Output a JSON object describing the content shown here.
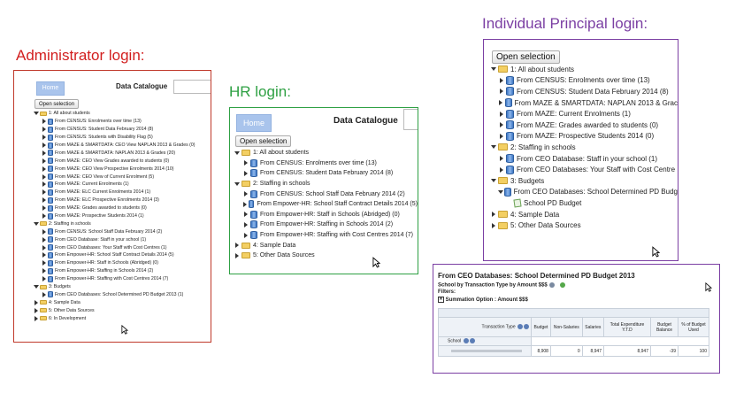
{
  "titles": {
    "admin": "Administrator login:",
    "hr": "HR login:",
    "principal": "Individual Principal login:"
  },
  "colors": {
    "admin": "#d21f1f",
    "hr": "#2ea043",
    "principal": "#7b3fa3"
  },
  "common": {
    "home": "Home",
    "catalogue": "Data Catalogue",
    "open_selection": "Open selection"
  },
  "admin_tree": [
    {
      "label": "1: All about students",
      "level": 0,
      "icon": "folder",
      "open": true
    },
    {
      "label": "From CENSUS: Enrolments over time (13)",
      "level": 1,
      "icon": "db"
    },
    {
      "label": "From CENSUS: Student Data February 2014 (8)",
      "level": 1,
      "icon": "db"
    },
    {
      "label": "From CENSUS: Students with Disability Flag (5)",
      "level": 1,
      "icon": "db"
    },
    {
      "label": "From MAZE & SMARTDATA: CEO View NAPLAN 2013 & Grades (0)",
      "level": 1,
      "icon": "db"
    },
    {
      "label": "From MAZE & SMARTDATA: NAPLAN 2013 & Grades (20)",
      "level": 1,
      "icon": "db"
    },
    {
      "label": "From MAZE: CEO View Grades awarded to students (0)",
      "level": 1,
      "icon": "db"
    },
    {
      "label": "From MAZE: CEO View Prospective Enrolments 2014 (10)",
      "level": 1,
      "icon": "db"
    },
    {
      "label": "From MAZE: CEO View of Current Enrolment (5)",
      "level": 1,
      "icon": "db"
    },
    {
      "label": "From MAZE: Current Enrolments (1)",
      "level": 1,
      "icon": "db"
    },
    {
      "label": "From MAZE: ELC Current Enrolments 2014 (1)",
      "level": 1,
      "icon": "db"
    },
    {
      "label": "From MAZE: ELC Prospective Enrolments 2014 (3)",
      "level": 1,
      "icon": "db"
    },
    {
      "label": "From MAZE: Grades awarded to students (0)",
      "level": 1,
      "icon": "db"
    },
    {
      "label": "From MAZE: Prospective Students 2014 (1)",
      "level": 1,
      "icon": "db"
    },
    {
      "label": "2: Staffing in schools",
      "level": 0,
      "icon": "folder",
      "open": true
    },
    {
      "label": "From CENSUS: School Staff Data February 2014 (2)",
      "level": 1,
      "icon": "db"
    },
    {
      "label": "From CEO Database: Staff in your school (1)",
      "level": 1,
      "icon": "db"
    },
    {
      "label": "From CEO Databases: Your Staff with Cost Centres (1)",
      "level": 1,
      "icon": "db"
    },
    {
      "label": "From Empower-HR: School Staff Contract Details 2014 (5)",
      "level": 1,
      "icon": "db"
    },
    {
      "label": "From Empower-HR: Staff in Schools (Abridged) (0)",
      "level": 1,
      "icon": "db"
    },
    {
      "label": "From Empower-HR: Staffing in Schools 2014 (2)",
      "level": 1,
      "icon": "db"
    },
    {
      "label": "From Empower-HR: Staffing with Cost Centres 2014 (7)",
      "level": 1,
      "icon": "db"
    },
    {
      "label": "3: Budgets",
      "level": 0,
      "icon": "folder",
      "open": true
    },
    {
      "label": "From CEO Databases: School Determined PD Budget 2013 (1)",
      "level": 1,
      "icon": "db"
    },
    {
      "label": "4: Sample Data",
      "level": 0,
      "icon": "folder",
      "open": false
    },
    {
      "label": "5: Other Data Sources",
      "level": 0,
      "icon": "folder",
      "open": false
    },
    {
      "label": "6: In Development",
      "level": 0,
      "icon": "folder",
      "open": false
    }
  ],
  "hr_tree": [
    {
      "label": "1: All about students",
      "level": 0,
      "icon": "folder",
      "open": true
    },
    {
      "label": "From CENSUS: Enrolments over time (13)",
      "level": 1,
      "icon": "db"
    },
    {
      "label": "From CENSUS: Student Data February 2014 (8)",
      "level": 1,
      "icon": "db"
    },
    {
      "label": "2: Staffing in schools",
      "level": 0,
      "icon": "folder",
      "open": true
    },
    {
      "label": "From CENSUS: School Staff Data February 2014 (2)",
      "level": 1,
      "icon": "db"
    },
    {
      "label": "From Empower-HR: School Staff Contract Details 2014 (5)",
      "level": 1,
      "icon": "db"
    },
    {
      "label": "From Empower-HR: Staff in Schools (Abridged) (0)",
      "level": 1,
      "icon": "db"
    },
    {
      "label": "From Empower-HR: Staffing in Schools 2014 (2)",
      "level": 1,
      "icon": "db"
    },
    {
      "label": "From Empower-HR: Staffing with Cost Centres 2014 (7)",
      "level": 1,
      "icon": "db"
    },
    {
      "label": "4: Sample Data",
      "level": 0,
      "icon": "folder",
      "open": false
    },
    {
      "label": "5: Other Data Sources",
      "level": 0,
      "icon": "folder",
      "open": false
    }
  ],
  "principal_tree": [
    {
      "label": "1: All about students",
      "level": 0,
      "icon": "folder",
      "open": true
    },
    {
      "label": "From CENSUS: Enrolments over time (13)",
      "level": 1,
      "icon": "db"
    },
    {
      "label": "From CENSUS: Student Data February 2014 (8)",
      "level": 1,
      "icon": "db"
    },
    {
      "label": "From MAZE & SMARTDATA: NAPLAN 2013 & Grac",
      "level": 1,
      "icon": "db"
    },
    {
      "label": "From MAZE: Current Enrolments (1)",
      "level": 1,
      "icon": "db"
    },
    {
      "label": "From MAZE: Grades awarded to students (0)",
      "level": 1,
      "icon": "db"
    },
    {
      "label": "From MAZE: Prospective Students 2014 (0)",
      "level": 1,
      "icon": "db"
    },
    {
      "label": "2: Staffing in schools",
      "level": 0,
      "icon": "folder",
      "open": true
    },
    {
      "label": "From CEO Database: Staff in your school (1)",
      "level": 1,
      "icon": "db"
    },
    {
      "label": "From CEO Databases: Your Staff with Cost Centre",
      "level": 1,
      "icon": "db"
    },
    {
      "label": "3: Budgets",
      "level": 0,
      "icon": "folder",
      "open": true
    },
    {
      "label": "From CEO Databases: School Determined PD Budg",
      "level": 1,
      "icon": "db",
      "open": true
    },
    {
      "label": "School PD Budget",
      "level": 2,
      "icon": "report"
    },
    {
      "label": "4: Sample Data",
      "level": 0,
      "icon": "folder",
      "open": false
    },
    {
      "label": "5: Other Data Sources",
      "level": 0,
      "icon": "folder",
      "open": false
    }
  ],
  "report": {
    "title": "From CEO Databases: School Determined PD Budget 2013",
    "subtitle": "School by Transaction Type by Amount $$$",
    "filters": "Filters:",
    "summation": "Summation Option : Amount $$$",
    "headers": [
      "Transaction Type",
      "Budget",
      "Non-Salaries",
      "Salaries",
      "Total Expenditure Y.T.D",
      "Budget Balance",
      "% of Budget Used"
    ],
    "row_header": "School",
    "row_values": [
      "8,908",
      "0",
      "8,947",
      "8,947",
      "-39",
      "100"
    ]
  }
}
